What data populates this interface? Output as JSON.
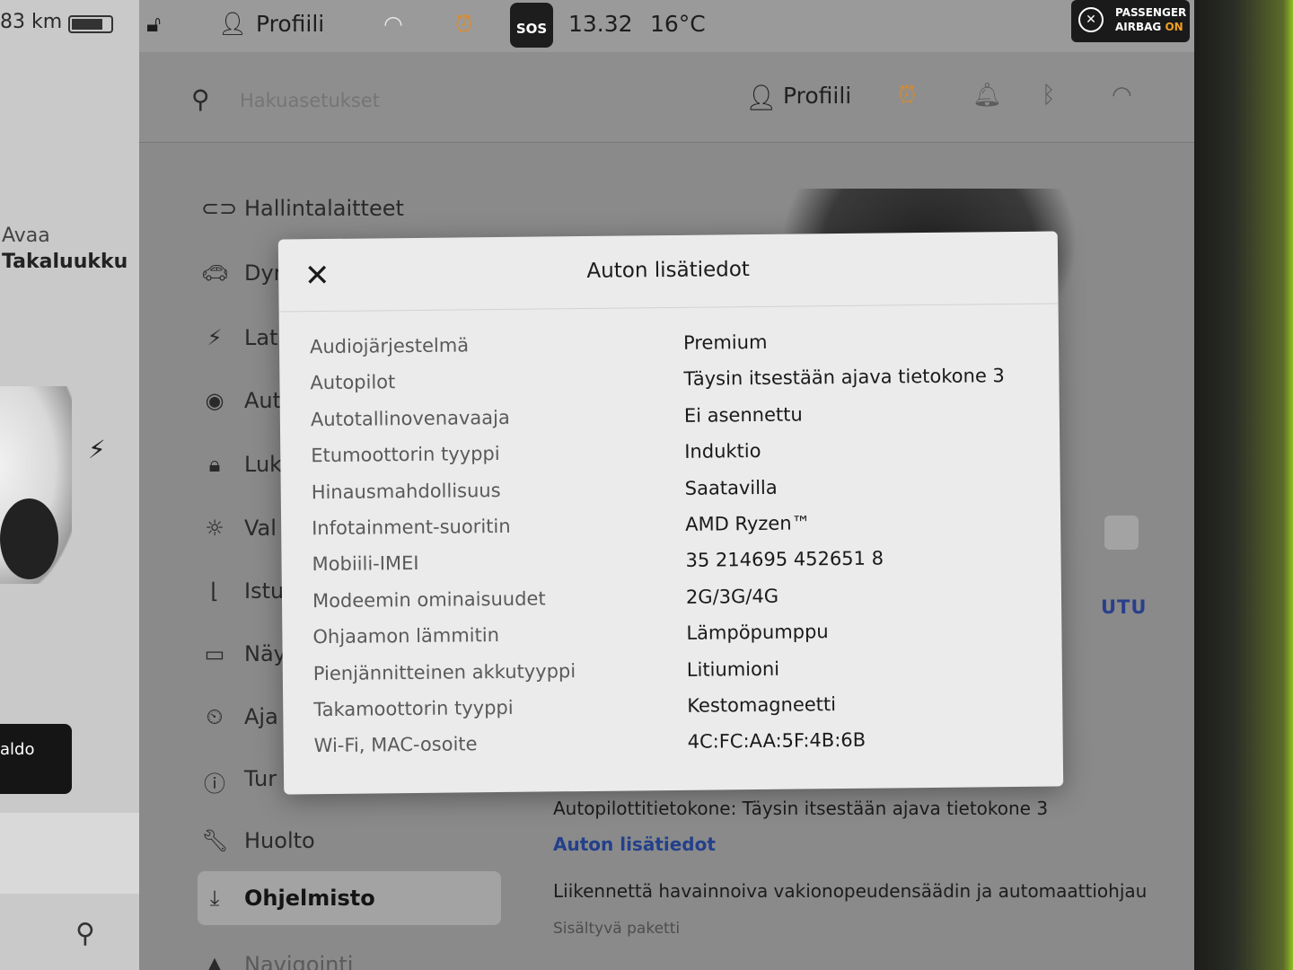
{
  "left_pane": {
    "range": "83 km",
    "battery_level": 0.8,
    "open_action": "Avaa",
    "open_target": "Takaluukku",
    "bottom_button": "aldo"
  },
  "status_bar": {
    "profile": "Profiili",
    "sos": "SOS",
    "time": "13.32",
    "temperature": "16°C",
    "airbag_line1": "PASSENGER",
    "airbag_line2": "AIRBAG",
    "airbag_state": "ON"
  },
  "settings_header": {
    "search_placeholder": "Hakuasetukset",
    "profile": "Profiili"
  },
  "menu": {
    "items": [
      {
        "label": "Hallintalaitteet",
        "icon": "toggle-icon"
      },
      {
        "label": "Dyr",
        "icon": "car-icon"
      },
      {
        "label": "Lat",
        "icon": "bolt-icon"
      },
      {
        "label": "Aut",
        "icon": "steering-wheel-icon"
      },
      {
        "label": "Luk",
        "icon": "lock-icon"
      },
      {
        "label": "Val",
        "icon": "sun-icon"
      },
      {
        "label": "Istu",
        "icon": "seat-icon"
      },
      {
        "label": "Näy",
        "icon": "display-icon"
      },
      {
        "label": "Aja",
        "icon": "schedule-icon"
      },
      {
        "label": "Tur",
        "icon": "safety-icon"
      },
      {
        "label": "Huolto",
        "icon": "wrench-icon"
      },
      {
        "label": "Ohjelmisto",
        "icon": "download-icon"
      },
      {
        "label": "Navigointi",
        "icon": "navigation-icon"
      }
    ]
  },
  "content": {
    "utu_link": "UTU",
    "autopilot_computer": "Autopilottitietokone: Täysin itsestään ajava tietokone 3",
    "more_info_link": "Auton lisätiedot",
    "traffic_aware_title": "Liikennettä havainnoiva vakionopeudensäädin ja automaattiohjau",
    "traffic_aware_sub": "Sisältyvä paketti"
  },
  "modal": {
    "title": "Auton lisätiedot",
    "rows": [
      {
        "key": "Audiojärjestelmä",
        "value": "Premium"
      },
      {
        "key": "Autopilot",
        "value": "Täysin itsestään ajava tietokone 3"
      },
      {
        "key": "Autotallinovenavaaja",
        "value": "Ei asennettu"
      },
      {
        "key": "Etumoottorin tyyppi",
        "value": "Induktio"
      },
      {
        "key": "Hinausmahdollisuus",
        "value": "Saatavilla"
      },
      {
        "key": "Infotainment-suoritin",
        "value": "AMD Ryzen™"
      },
      {
        "key": "Mobiili-IMEI",
        "value": "35 214695 452651 8"
      },
      {
        "key": "Modeemin ominaisuudet",
        "value": "2G/3G/4G"
      },
      {
        "key": "Ohjaamon lämmitin",
        "value": "Lämpöpumppu"
      },
      {
        "key": "Pienjännitteinen akkutyyppi",
        "value": "Litiumioni"
      },
      {
        "key": "Takamoottorin tyyppi",
        "value": "Kestomagneetti"
      },
      {
        "key": "Wi-Fi, MAC-osoite",
        "value": "4C:FC:AA:5F:4B:6B"
      }
    ]
  }
}
